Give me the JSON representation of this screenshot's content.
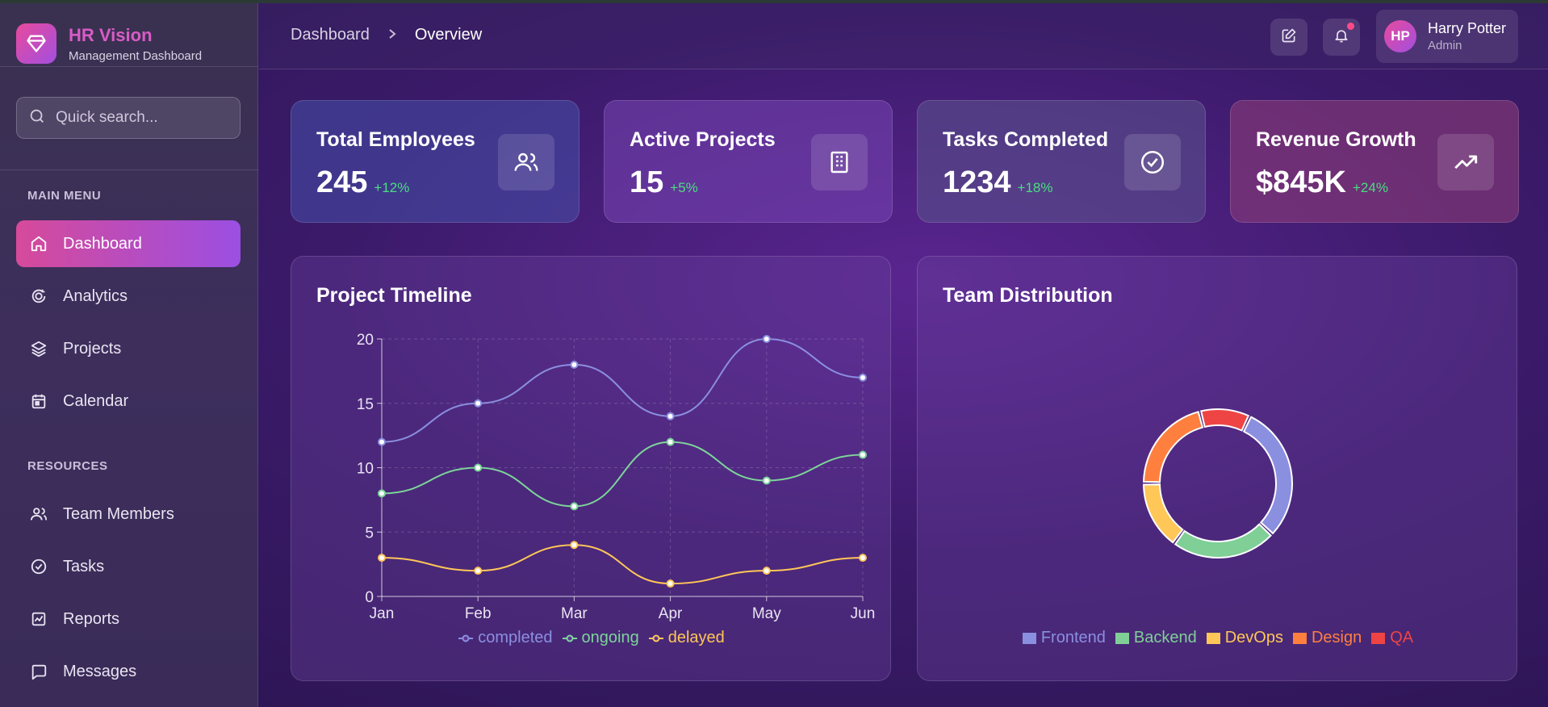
{
  "brand": {
    "title": "HR Vision",
    "subtitle": "Management Dashboard"
  },
  "search": {
    "placeholder": "Quick search..."
  },
  "sidebar": {
    "main_label": "MAIN MENU",
    "main_items": [
      {
        "label": "Dashboard",
        "icon": "home-icon",
        "active": true
      },
      {
        "label": "Analytics",
        "icon": "analytics-icon"
      },
      {
        "label": "Projects",
        "icon": "layers-icon"
      },
      {
        "label": "Calendar",
        "icon": "calendar-icon"
      }
    ],
    "resources_label": "RESOURCES",
    "resource_items": [
      {
        "label": "Team Members",
        "icon": "users-icon"
      },
      {
        "label": "Tasks",
        "icon": "check-circle-icon"
      },
      {
        "label": "Reports",
        "icon": "report-chart-icon"
      },
      {
        "label": "Messages",
        "icon": "message-icon"
      }
    ]
  },
  "header": {
    "breadcrumb": [
      "Dashboard",
      "Overview"
    ],
    "user": {
      "initials": "HP",
      "name": "Harry Potter",
      "role": "Admin"
    }
  },
  "stats": [
    {
      "title": "Total Employees",
      "value": "245",
      "change": "+12%",
      "icon": "users-icon"
    },
    {
      "title": "Active Projects",
      "value": "15",
      "change": "+5%",
      "icon": "building-icon"
    },
    {
      "title": "Tasks Completed",
      "value": "1234",
      "change": "+18%",
      "icon": "check-circle-icon"
    },
    {
      "title": "Revenue Growth",
      "value": "$845K",
      "change": "+24%",
      "icon": "trending-up-icon"
    }
  ],
  "timeline": {
    "title": "Project Timeline"
  },
  "distribution": {
    "title": "Team Distribution"
  },
  "chart_data": [
    {
      "type": "line",
      "x": [
        "Jan",
        "Feb",
        "Mar",
        "Apr",
        "May",
        "Jun"
      ],
      "ylim": [
        0,
        20
      ],
      "yticks": [
        0,
        5,
        10,
        15,
        20
      ],
      "grid": true,
      "legend": "bottom",
      "series": [
        {
          "name": "completed",
          "values": [
            12,
            15,
            18,
            14,
            20,
            17
          ],
          "color": "#8b8fe0"
        },
        {
          "name": "ongoing",
          "values": [
            8,
            10,
            7,
            12,
            9,
            11
          ],
          "color": "#7dd49a"
        },
        {
          "name": "delayed",
          "values": [
            3,
            2,
            4,
            1,
            2,
            3
          ],
          "color": "#ffc658"
        }
      ]
    },
    {
      "type": "pie",
      "categories": [
        "Frontend",
        "Backend",
        "DevOps",
        "Design",
        "QA"
      ],
      "values": [
        30,
        23,
        15,
        21,
        11
      ],
      "colors": [
        "#8b8fe0",
        "#7fcf97",
        "#ffc658",
        "#ff7f3f",
        "#ef4444"
      ],
      "legend": "bottom"
    }
  ]
}
